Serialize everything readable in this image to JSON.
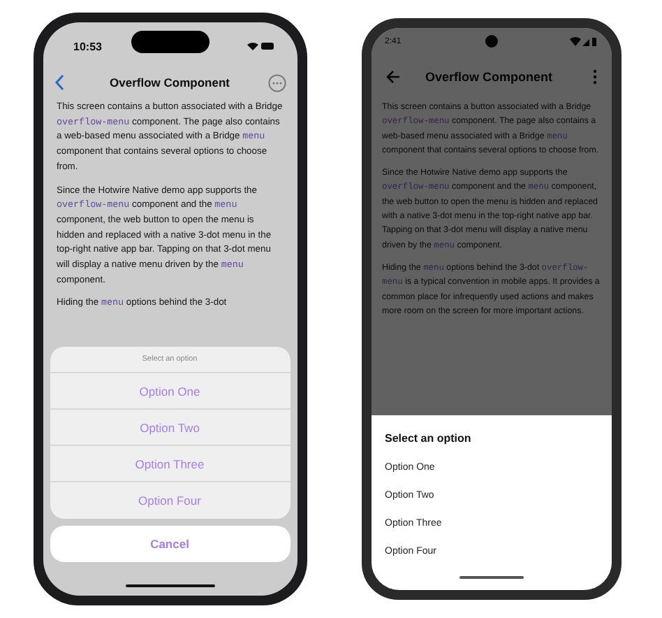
{
  "phones": [
    {
      "kind": "ios",
      "time": "10:53",
      "title": "Overflow Component",
      "dimmed": true,
      "paragraphs": [
        [
          {
            "text": "This screen contains a button associated with a Bridge ",
            "code": false
          },
          {
            "text": "overflow-menu",
            "code": true
          },
          {
            "text": " component. The page also contains a web-based menu associated with a Bridge ",
            "code": false
          },
          {
            "text": "menu",
            "code": true
          },
          {
            "text": " component that contains several options to choose from.",
            "code": false
          }
        ],
        [
          {
            "text": "Since the Hotwire Native demo app supports the ",
            "code": false
          },
          {
            "text": "overflow-menu",
            "code": true
          },
          {
            "text": " component and the ",
            "code": false
          },
          {
            "text": "menu",
            "code": true
          },
          {
            "text": " component, the web button to open the menu is hidden and replaced with a native 3-dot menu in the top-right native app bar. Tapping on that 3-dot menu will display a native menu driven by the ",
            "code": false
          },
          {
            "text": "menu",
            "code": true
          },
          {
            "text": " component.",
            "code": false
          }
        ],
        [
          {
            "text": "Hiding the ",
            "code": false
          },
          {
            "text": "menu",
            "code": true
          },
          {
            "text": " options behind the 3-dot",
            "code": false
          }
        ]
      ],
      "sheet": {
        "title": "Select an option",
        "options": [
          "Option One",
          "Option Two",
          "Option Three",
          "Option Four"
        ],
        "cancel": "Cancel"
      }
    },
    {
      "kind": "android",
      "time": "2:41",
      "title": "Overflow Component",
      "dimmed": true,
      "paragraphs": [
        [
          {
            "text": "This screen contains a button associated with a Bridge ",
            "code": false
          },
          {
            "text": "overflow-menu",
            "code": true
          },
          {
            "text": " component. The page also contains a web-based menu associated with a Bridge ",
            "code": false
          },
          {
            "text": "menu",
            "code": true
          },
          {
            "text": " component that contains several options to choose from.",
            "code": false
          }
        ],
        [
          {
            "text": "Since the Hotwire Native demo app supports the ",
            "code": false
          },
          {
            "text": "overflow-menu",
            "code": true
          },
          {
            "text": " component and the ",
            "code": false
          },
          {
            "text": "menu",
            "code": true
          },
          {
            "text": " component, the web button to open the menu is hidden and replaced with a native 3-dot menu in the top-right native app bar. Tapping on that 3-dot menu will display a native menu driven by the ",
            "code": false
          },
          {
            "text": "menu",
            "code": true
          },
          {
            "text": " component.",
            "code": false
          }
        ],
        [
          {
            "text": "Hiding the ",
            "code": false
          },
          {
            "text": "menu",
            "code": true
          },
          {
            "text": " options behind the 3-dot ",
            "code": false
          },
          {
            "text": "overflow-menu",
            "code": true
          },
          {
            "text": " is a typical convention in mobile apps. It provides a common place for infrequently used actions and makes more room on the screen for more important actions.",
            "code": false
          }
        ]
      ],
      "sheet": {
        "title": "Select an option",
        "options": [
          "Option One",
          "Option Two",
          "Option Three",
          "Option Four"
        ]
      }
    }
  ]
}
